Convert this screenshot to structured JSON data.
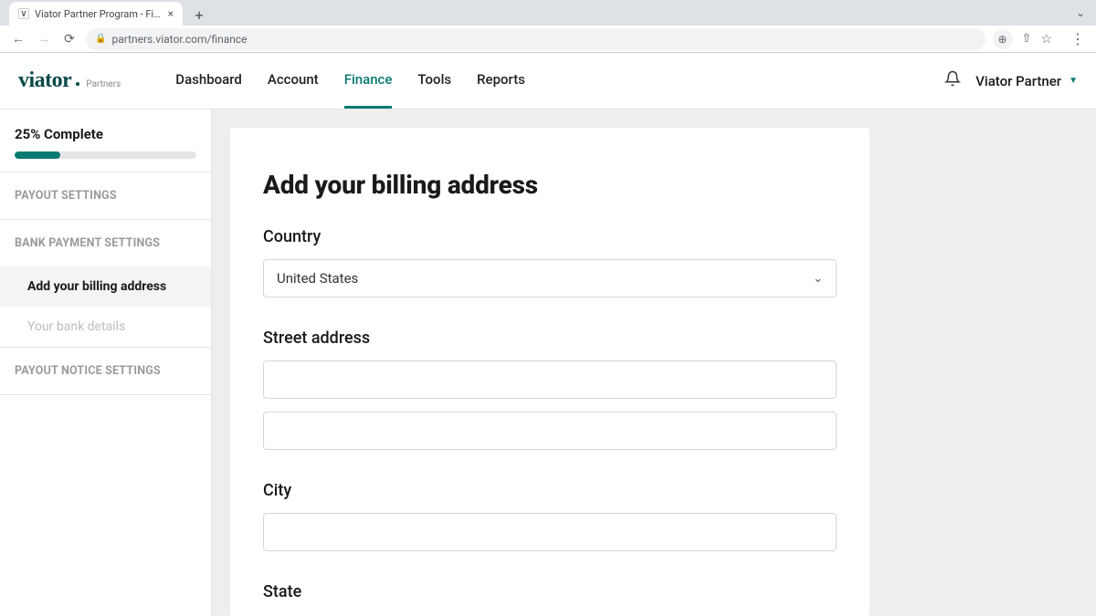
{
  "browser": {
    "tab_title": "Viator Partner Program - Finan",
    "url": "partners.viator.com/finance"
  },
  "header": {
    "logo_main": "viator",
    "logo_sub": "Partners",
    "nav": [
      {
        "label": "Dashboard",
        "active": false
      },
      {
        "label": "Account",
        "active": false
      },
      {
        "label": "Finance",
        "active": true
      },
      {
        "label": "Tools",
        "active": false
      },
      {
        "label": "Reports",
        "active": false
      }
    ],
    "user_label": "Viator Partner"
  },
  "sidebar": {
    "progress_label": "25% Complete",
    "progress_pct": 25,
    "sections": [
      {
        "header": "PAYOUT SETTINGS",
        "items": []
      },
      {
        "header": "BANK PAYMENT SETTINGS",
        "items": [
          {
            "label": "Add your billing address",
            "active": true
          },
          {
            "label": "Your bank details",
            "active": false
          }
        ]
      },
      {
        "header": "PAYOUT NOTICE SETTINGS",
        "items": []
      }
    ]
  },
  "form": {
    "title": "Add your billing address",
    "country_label": "Country",
    "country_value": "United States",
    "street_label": "Street address",
    "street_value_1": "",
    "street_value_2": "",
    "city_label": "City",
    "city_value": "",
    "state_label": "State"
  }
}
